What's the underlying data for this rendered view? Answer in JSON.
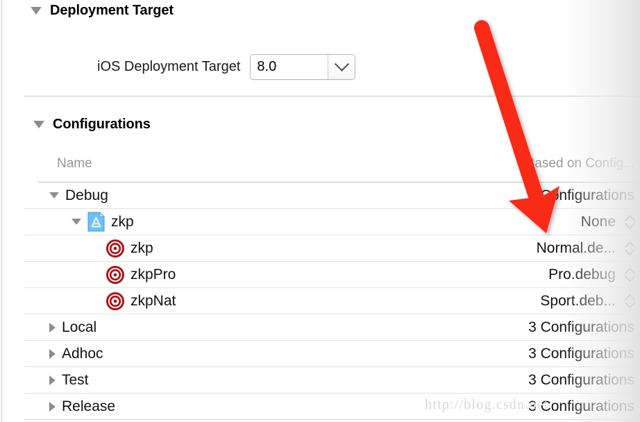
{
  "deployment_section": {
    "title": "Deployment Target",
    "disclosure_icon": "triangle-down-icon",
    "expanded": true,
    "field": {
      "label": "iOS Deployment Target",
      "value": "8.0",
      "dropdown_icon": "chevron-down-icon"
    }
  },
  "configurations_section": {
    "title": "Configurations",
    "disclosure_icon": "triangle-down-icon",
    "expanded": true,
    "columns": {
      "name": "Name",
      "based_on": "Based on Config..."
    },
    "rows": [
      {
        "level": 0,
        "name": "Debug",
        "disclosure_icon": "triangle-down-icon",
        "expanded": true,
        "icon": "",
        "value": "3 Configurations",
        "value_kind": "plain"
      },
      {
        "level": 1,
        "name": "zkp",
        "disclosure_icon": "triangle-down-icon",
        "expanded": true,
        "icon": "xcode-project-icon",
        "value": "None",
        "value_kind": "popup"
      },
      {
        "level": 2,
        "name": "zkp",
        "disclosure_icon": "",
        "expanded": false,
        "icon": "target-bullseye-icon",
        "value": "Normal.de...",
        "value_kind": "popup"
      },
      {
        "level": 2,
        "name": "zkpPro",
        "disclosure_icon": "",
        "expanded": false,
        "icon": "target-bullseye-icon",
        "value": "Pro.debug",
        "value_kind": "popup"
      },
      {
        "level": 2,
        "name": "zkpNat",
        "disclosure_icon": "",
        "expanded": false,
        "icon": "target-bullseye-icon",
        "value": "Sport.deb...",
        "value_kind": "popup"
      },
      {
        "level": 0,
        "name": "Local",
        "disclosure_icon": "triangle-right-icon",
        "expanded": false,
        "icon": "",
        "value": "3 Configurations",
        "value_kind": "plain"
      },
      {
        "level": 0,
        "name": "Adhoc",
        "disclosure_icon": "triangle-right-icon",
        "expanded": false,
        "icon": "",
        "value": "3 Configurations",
        "value_kind": "plain"
      },
      {
        "level": 0,
        "name": "Test",
        "disclosure_icon": "triangle-right-icon",
        "expanded": false,
        "icon": "",
        "value": "3 Configurations",
        "value_kind": "plain"
      },
      {
        "level": 0,
        "name": "Release",
        "disclosure_icon": "triangle-right-icon",
        "expanded": false,
        "icon": "",
        "value": "3 Configurations",
        "value_kind": "plain"
      }
    ]
  },
  "annotation": {
    "icon": "red-arrow-icon",
    "color": "#F92C18",
    "points_to": "None"
  },
  "watermark": {
    "text": "http://blog.csdn.net",
    "color": "#D8D8D8"
  }
}
